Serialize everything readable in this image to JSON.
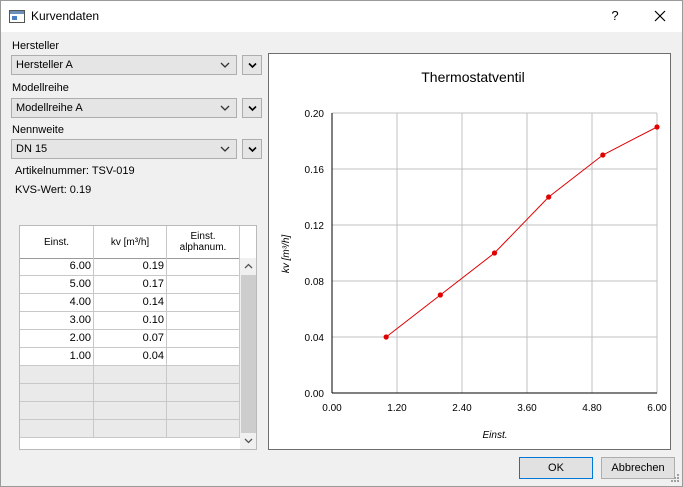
{
  "window": {
    "title": "Kurvendaten",
    "help": "?"
  },
  "form": {
    "hersteller_label": "Hersteller",
    "hersteller_value": "Hersteller A",
    "modellreihe_label": "Modellreihe",
    "modellreihe_value": "Modellreihe A",
    "nennweite_label": "Nennweite",
    "nennweite_value": "DN 15",
    "artikelnummer": "Artikelnummer: TSV-019",
    "kvs": "KVS-Wert: 0.19"
  },
  "table": {
    "headers": [
      "Einst.",
      "kv [m³/h]",
      "Einst.\nalphanum."
    ],
    "rows": [
      [
        "6.00",
        "0.19",
        ""
      ],
      [
        "5.00",
        "0.17",
        ""
      ],
      [
        "4.00",
        "0.14",
        ""
      ],
      [
        "3.00",
        "0.10",
        ""
      ],
      [
        "2.00",
        "0.07",
        ""
      ],
      [
        "1.00",
        "0.04",
        ""
      ]
    ]
  },
  "buttons": {
    "ok": "OK",
    "cancel": "Abbrechen"
  },
  "colors": {
    "series": "#e00000",
    "grid": "#c0c0c0"
  },
  "chart_data": {
    "type": "line",
    "title": "Thermostatventil",
    "xlabel": "Einst.",
    "ylabel": "kv [m³/h]",
    "xlim": [
      0,
      6
    ],
    "ylim": [
      0,
      0.2
    ],
    "xticks": [
      "0.00",
      "1.20",
      "2.40",
      "3.60",
      "4.80",
      "6.00"
    ],
    "yticks": [
      "0.00",
      "0.04",
      "0.08",
      "0.12",
      "0.16",
      "0.20"
    ],
    "grid": true,
    "series": [
      {
        "x": [
          1,
          2,
          3,
          4,
          5,
          6
        ],
        "y": [
          0.04,
          0.07,
          0.1,
          0.14,
          0.17,
          0.19
        ]
      }
    ]
  }
}
